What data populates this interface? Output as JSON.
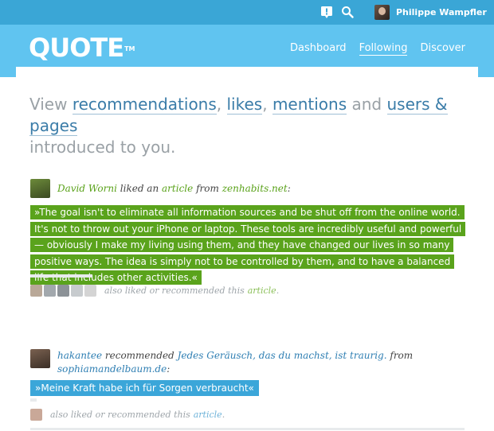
{
  "topbar": {
    "user_name": "Philippe Wampfler",
    "icons": [
      "notification-icon",
      "search-icon"
    ]
  },
  "header": {
    "logo": "QUOTE",
    "logo_tm": "TM",
    "nav": {
      "dashboard": "Dashboard",
      "following": "Following",
      "discover": "Discover"
    },
    "active_nav": "Following"
  },
  "intro": {
    "view": "View",
    "recommendations": "recommendations",
    "comma1": ",",
    "likes": "likes",
    "comma2": ",",
    "mentions": "mentions",
    "and": "and",
    "users_pages": "users & pages",
    "rest": "introduced to you."
  },
  "items": [
    {
      "user": "David Worni",
      "action": "liked an",
      "object": "article",
      "from": "from",
      "source": "zenhabits.net",
      "colon": ":",
      "quote": "»The goal isn't to eliminate all information sources and be shut off from the online world. It's not to throw out your iPhone or laptop. These tools are incredibly useful and powerful — obviously I make my living using them, and they have changed our lives in so many positive ways. The idea is simply not to be controlled by them, and to have a balanced life that includes other activities.«",
      "also_text": "also liked or recommended this",
      "also_link": "article",
      "also_end": "."
    },
    {
      "user": "hakantee",
      "action": "recommended",
      "object": "Jedes Geräusch, das du machst, ist traurig.",
      "from": "from",
      "source": "sophiamandelbaum.de",
      "colon": ":",
      "quote": "»Meine Kraft habe ich für Sorgen verbraucht«",
      "also_text": "also liked or recommended this",
      "also_link": "article",
      "also_end": "."
    }
  ],
  "colors": {
    "topbar": "#3aa6d6",
    "header": "#60c4f0",
    "green_highlight": "#5aa31c",
    "blue_highlight": "#3ba6d9",
    "link_blue": "#2f7fb3",
    "link_green": "#5aa21a"
  }
}
